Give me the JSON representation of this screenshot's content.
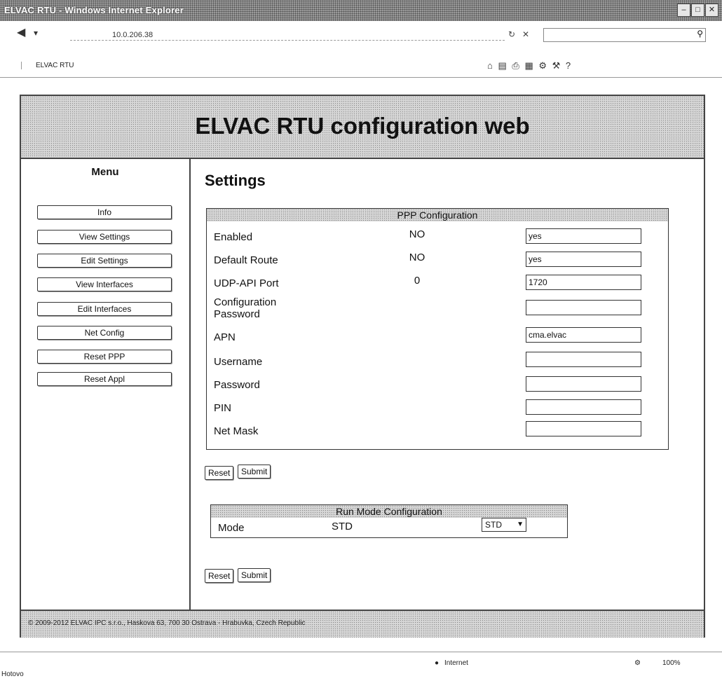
{
  "window": {
    "title": "ELVAC RTU - Windows Internet Explorer",
    "controls": [
      "minimize",
      "maximize",
      "close"
    ]
  },
  "browser": {
    "address": "10.0.206.38",
    "tab_label": "ELVAC RTU",
    "status_left": "Hotovo",
    "status_zone": "Internet",
    "zoom": "100%"
  },
  "page": {
    "header_title": "ELVAC RTU configuration web",
    "menu_title": "Menu",
    "menu": [
      "Info",
      "View Settings",
      "Edit Settings",
      "View Interfaces",
      "Edit Interfaces",
      "Net Config",
      "Reset PPP",
      "Reset Appl"
    ],
    "settings_title": "Settings",
    "ppp": {
      "heading": "PPP Configuration",
      "rows": [
        {
          "label": "Enabled",
          "current": "NO",
          "input": "yes"
        },
        {
          "label": "Default Route",
          "current": "NO",
          "input": "yes"
        },
        {
          "label": "UDP-API Port",
          "current": "0",
          "input": "1720"
        },
        {
          "label": "Configuration\nPassword",
          "current": "",
          "input": ""
        },
        {
          "label": "APN",
          "current": "",
          "input": "cma.elvac"
        },
        {
          "label": "Username",
          "current": "",
          "input": ""
        },
        {
          "label": "Password",
          "current": "",
          "input": ""
        },
        {
          "label": "PIN",
          "current": "",
          "input": ""
        },
        {
          "label": "Net Mask",
          "current": "",
          "input": ""
        }
      ],
      "reset_label": "Reset",
      "submit_label": "Submit"
    },
    "run_mode": {
      "heading": "Run Mode Configuration",
      "label": "Mode",
      "current": "STD",
      "selected": "STD",
      "reset_label": "Reset",
      "submit_label": "Submit"
    },
    "footer": "© 2009-2012 ELVAC IPC s.r.o., Haskova 63, 700 30 Ostrava - Hrabuvka, Czech Republic"
  }
}
